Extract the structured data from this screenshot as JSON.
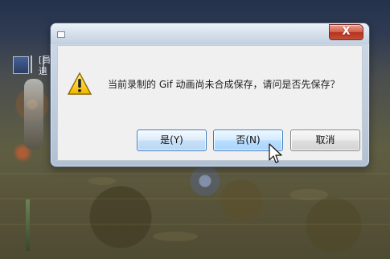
{
  "background_hud": {
    "tag_1": "[員",
    "tag_2": "退"
  },
  "dialog": {
    "message": "当前录制的 Gif 动画尚未合成保存，请问是否先保存？",
    "buttons": {
      "yes": "是(Y)",
      "no": "否(N)",
      "cancel": "取消"
    },
    "close_symbol": "X",
    "icons": {
      "warning": "warning-icon",
      "close": "close-icon",
      "window": "window-icon",
      "cursor": "cursor-icon"
    }
  },
  "colors": {
    "dialog_panel": "#f0f0f0",
    "dialog_frame": "#c1cfe0",
    "close_button": "#c44f37",
    "focused_button_border": "#3c7fc7",
    "warning_fill": "#f2c500"
  }
}
